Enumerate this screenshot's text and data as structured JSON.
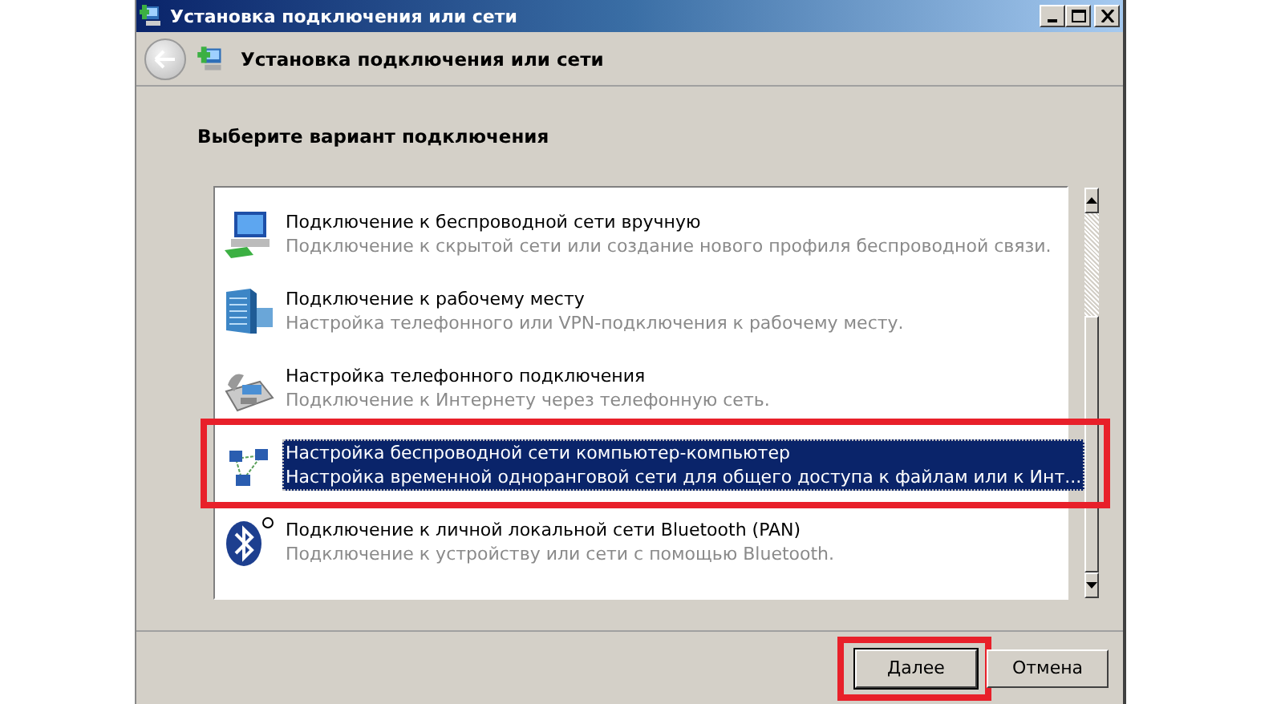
{
  "window": {
    "title": "Установка подключения или сети"
  },
  "toolbar": {
    "title": "Установка подключения или сети"
  },
  "heading": "Выберите вариант подключения",
  "options": [
    {
      "kind": "wireless",
      "title": "Подключение к беспроводной сети вручную",
      "description": "Подключение к скрытой сети или создание нового профиля беспроводной связи.",
      "selected": false,
      "annotated": false
    },
    {
      "kind": "workplace",
      "title": "Подключение к рабочему месту",
      "description": "Настройка телефонного или VPN-подключения к рабочему месту.",
      "selected": false,
      "annotated": false
    },
    {
      "kind": "phone",
      "title": "Настройка телефонного подключения",
      "description": "Подключение к Интернету через телефонную сеть.",
      "selected": false,
      "annotated": false
    },
    {
      "kind": "adhoc",
      "title": "Настройка беспроводной сети компьютер-компьютер",
      "description": "Настройка временной одноранговой сети для общего доступа к файлам или к Инт...",
      "selected": true,
      "annotated": true
    },
    {
      "kind": "bluetooth",
      "title": "Подключение к личной локальной сети Bluetooth (PAN)",
      "description": "Подключение к устройству или сети с помощью Bluetooth.",
      "selected": false,
      "annotated": false
    }
  ],
  "buttons": [
    {
      "label": "Далее",
      "default": true,
      "annotated": true
    },
    {
      "label": "Отмена",
      "default": false,
      "annotated": false
    }
  ]
}
